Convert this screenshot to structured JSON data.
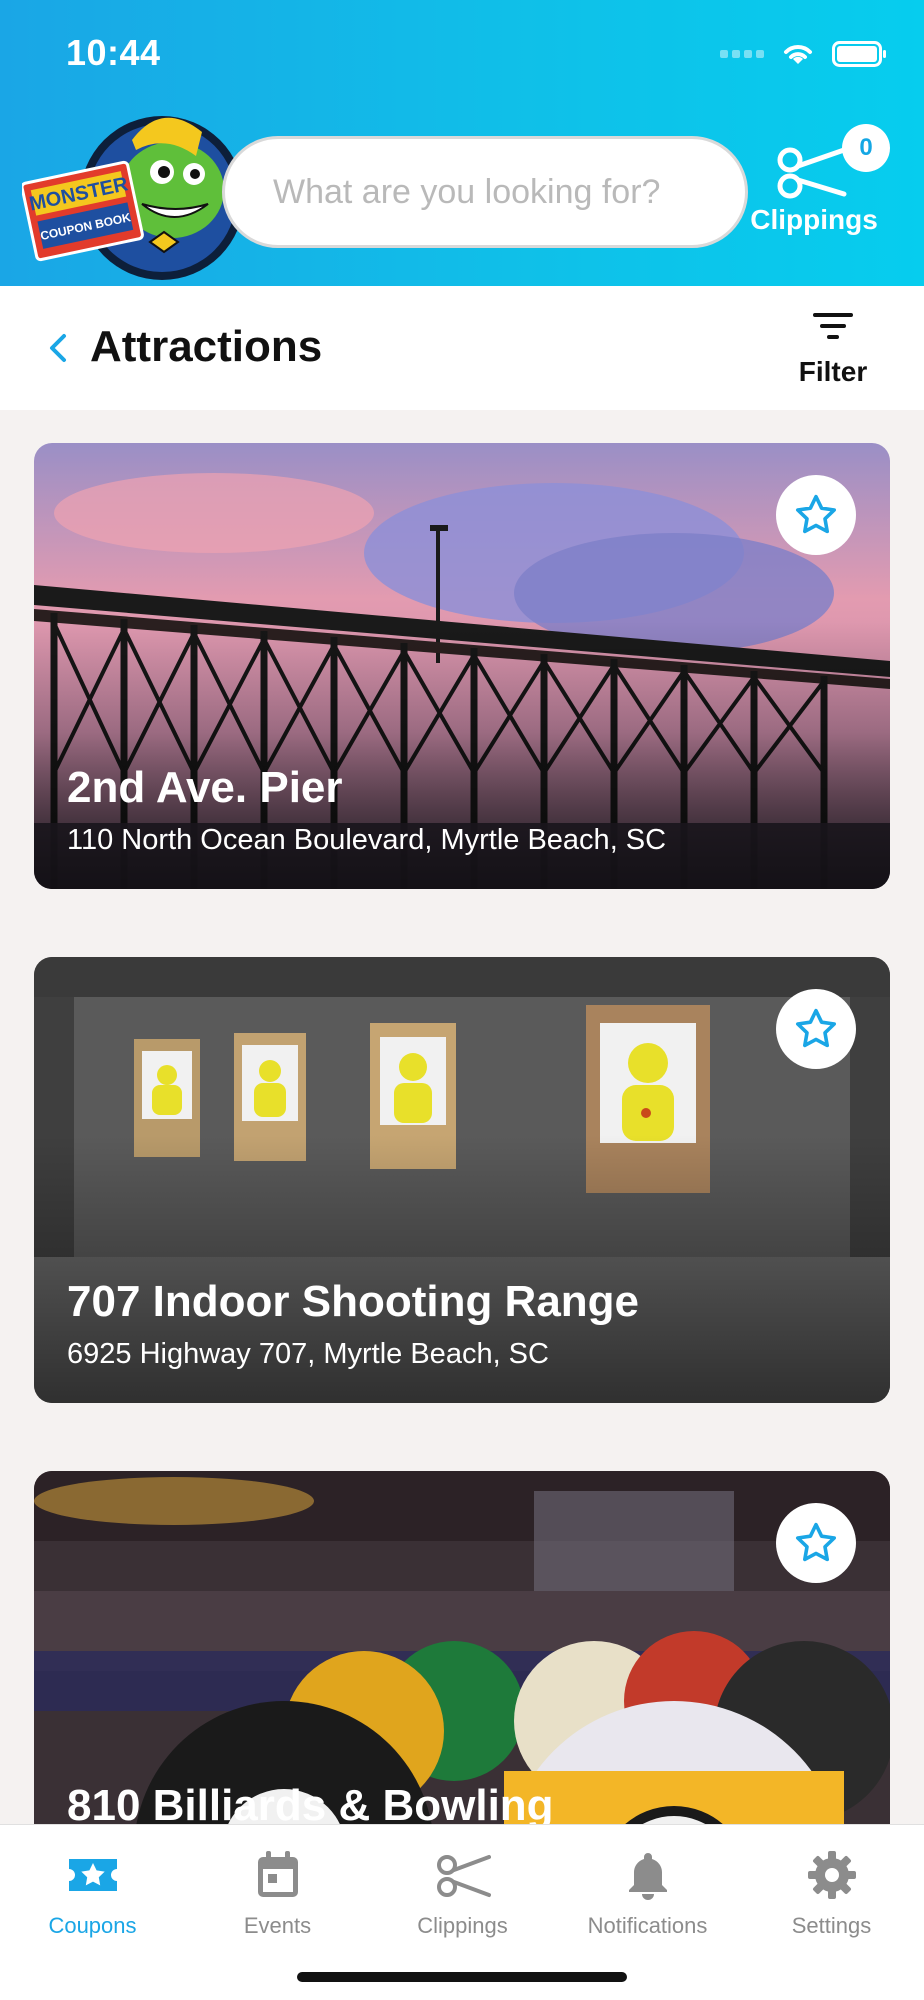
{
  "status": {
    "time": "10:44"
  },
  "header": {
    "logo_text_top": "MONSTER",
    "logo_text_bottom": "COUPON BOOK",
    "search_placeholder": "What are you looking for?",
    "clippings_count": "0",
    "clippings_label": "Clippings"
  },
  "subheader": {
    "title": "Attractions",
    "filter_label": "Filter"
  },
  "cards": [
    {
      "title": "2nd Ave. Pier",
      "address": "110 North Ocean Boulevard, Myrtle Beach, SC",
      "favorite": false
    },
    {
      "title": "707 Indoor Shooting Range",
      "address": "6925 Highway 707, Myrtle Beach, SC",
      "favorite": false
    },
    {
      "title": "810 Billiards & Bowling",
      "address": "",
      "favorite": false
    }
  ],
  "tabs": [
    {
      "label": "Coupons",
      "icon": "coupon-star-icon",
      "active": true
    },
    {
      "label": "Events",
      "icon": "calendar-icon",
      "active": false
    },
    {
      "label": "Clippings",
      "icon": "scissors-icon",
      "active": false
    },
    {
      "label": "Notifications",
      "icon": "bell-icon",
      "active": false
    },
    {
      "label": "Settings",
      "icon": "gear-icon",
      "active": false
    }
  ],
  "colors": {
    "accent": "#1aa6e6",
    "header_start": "#1aa6e6",
    "header_end": "#06cdee"
  }
}
